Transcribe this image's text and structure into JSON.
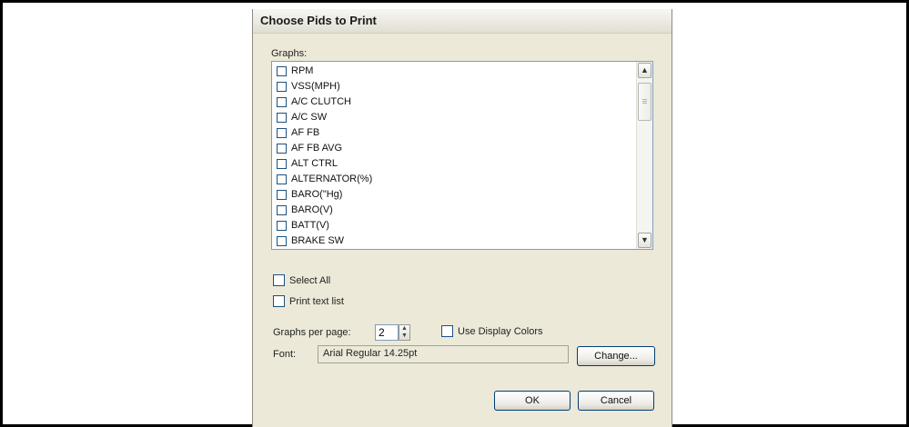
{
  "dialog": {
    "title": "Choose Pids to Print",
    "graphs_label": "Graphs:",
    "graph_items": [
      {
        "label": "RPM"
      },
      {
        "label": "VSS(MPH)"
      },
      {
        "label": "A/C CLUTCH"
      },
      {
        "label": "A/C SW"
      },
      {
        "label": "AF FB"
      },
      {
        "label": "AF FB AVG"
      },
      {
        "label": "ALT CTRL"
      },
      {
        "label": "ALTERNATOR(%)"
      },
      {
        "label": "BARO(\"Hg)"
      },
      {
        "label": "BARO(V)"
      },
      {
        "label": "BATT(V)"
      },
      {
        "label": "BRAKE SW"
      }
    ],
    "select_all_label": "Select All",
    "print_text_list_label": "Print text list",
    "graphs_per_page_label": "Graphs per page:",
    "graphs_per_page_value": "2",
    "use_display_colors_label": "Use Display Colors",
    "font_label": "Font:",
    "font_value": "Arial Regular 14.25pt",
    "change_label": "Change...",
    "ok_label": "OK",
    "cancel_label": "Cancel"
  }
}
